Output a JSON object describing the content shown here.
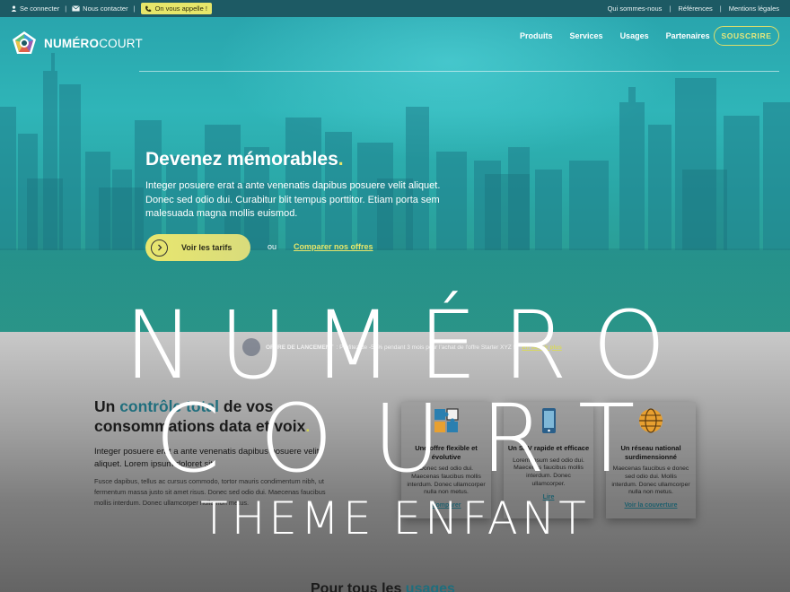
{
  "topbar": {
    "login": "Se connecter",
    "contact": "Nous contacter",
    "callback": "On vous appelle !",
    "links": [
      "Qui sommes-nous",
      "Références",
      "Mentions légales"
    ]
  },
  "nav": {
    "logo_bold": "NUMÉRO",
    "logo_light": "COURT",
    "menu": [
      "Produits",
      "Services",
      "Usages",
      "Partenaires"
    ],
    "subscribe": "SOUSCRIRE"
  },
  "hero": {
    "title": "Devenez mémorables",
    "title_dot": ".",
    "paragraph": "Integer posuere erat a ante venenatis dapibus posuere velit aliquet. Donec sed odio dui. Curabitur blit tempus porttitor. Etiam porta sem malesuada magna mollis euismod.",
    "cta": "Voir les tarifs",
    "or": "ou",
    "compare": "Comparer nos offres"
  },
  "promo": {
    "label": "OFFRE DE LANCEMENT",
    "text": ": Profitez de -50% pendant 3 mois pour l'achat de l'offre Starter XYZ !",
    "more": "En savoir plus"
  },
  "section": {
    "title_pre": "Un ",
    "title_highlight": "contrôle total",
    "title_post": " de vos consommations data et voix",
    "title_dot": ".",
    "lead": "Integer posuere erat a ante venenatis dapibus posuere velit aliquet. Lorem ipsum doloret sit.",
    "body": "Fusce dapibus, tellus ac cursus commodo, tortor mauris condimentum nibh, ut fermentum massa justo sit amet risus. Donec sed odio dui. Maecenas faucibus mollis interdum. Donec ullamcorper nulla non metus."
  },
  "cards": [
    {
      "icon": "puzzle-icon",
      "title": "Une offre flexible et évolutive",
      "text": "Donec sed odio dui. Maecenas faucibus mollis interdum. Donec ullamcorper nulla non metus.",
      "link": "Comparer"
    },
    {
      "icon": "phone-icon",
      "title": "Un SAV rapide et efficace",
      "text": "Lorem ipsum sed odio dui. Maecenas faucibus mollis interdum. Donec ullamcorper.",
      "link": "Lire"
    },
    {
      "icon": "globe-icon",
      "title": "Un réseau national surdimensionné",
      "text": "Maecenas faucibus e donec sed odio dui. Mollis interdum. Donec ullamcorper nulla non metus.",
      "link": "Voir la couverture"
    }
  ],
  "bottom": {
    "title_pre": "Pour tous les ",
    "title_highlight": "usages"
  },
  "watermark": {
    "line1": "NUMÉRO",
    "line2": "COURT",
    "line3": "THEME ENFANT"
  },
  "colors": {
    "accent_yellow": "#e6e66a",
    "teal": "#2fb5b8",
    "dark_teal": "#1d5a64"
  }
}
